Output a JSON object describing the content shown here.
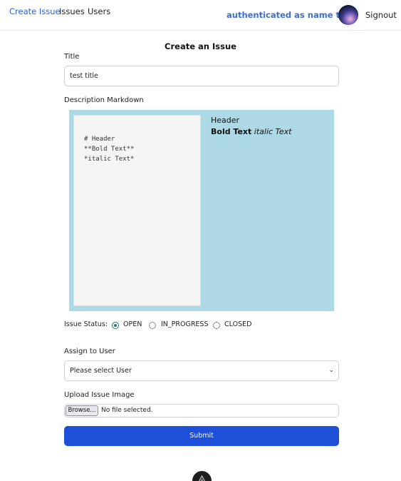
{
  "nav": {
    "links": [
      "Create Issue",
      "Issues",
      "Users"
    ],
    "auth_text": "authenticated as name test",
    "signout": "Signout"
  },
  "form": {
    "title": "Create an Issue",
    "title_label": "Title",
    "title_value": "test title",
    "description_label": "Description Markdown",
    "markdown_source": "# Header\n**Bold Text**\n*italic Text*",
    "preview": {
      "header": "Header",
      "bold": "Bold Text",
      "italic": "italic Text"
    },
    "status_label": "Issue Status:",
    "status_options": [
      "OPEN",
      "IN_PROGRESS",
      "CLOSED"
    ],
    "status_selected": "OPEN",
    "assign_label": "Assign to User",
    "assign_value": "Please select User",
    "upload_label": "Upload Issue Image",
    "browse_label": "Browse...",
    "file_text": "No file selected.",
    "submit_label": "Submit"
  },
  "colors": {
    "accent": "#1d4fd8",
    "link_active": "#2b63d9",
    "markdown_bg": "#add8e6"
  },
  "icons": {
    "footer": "app-logo-icon",
    "select": "chevron-down-icon"
  }
}
